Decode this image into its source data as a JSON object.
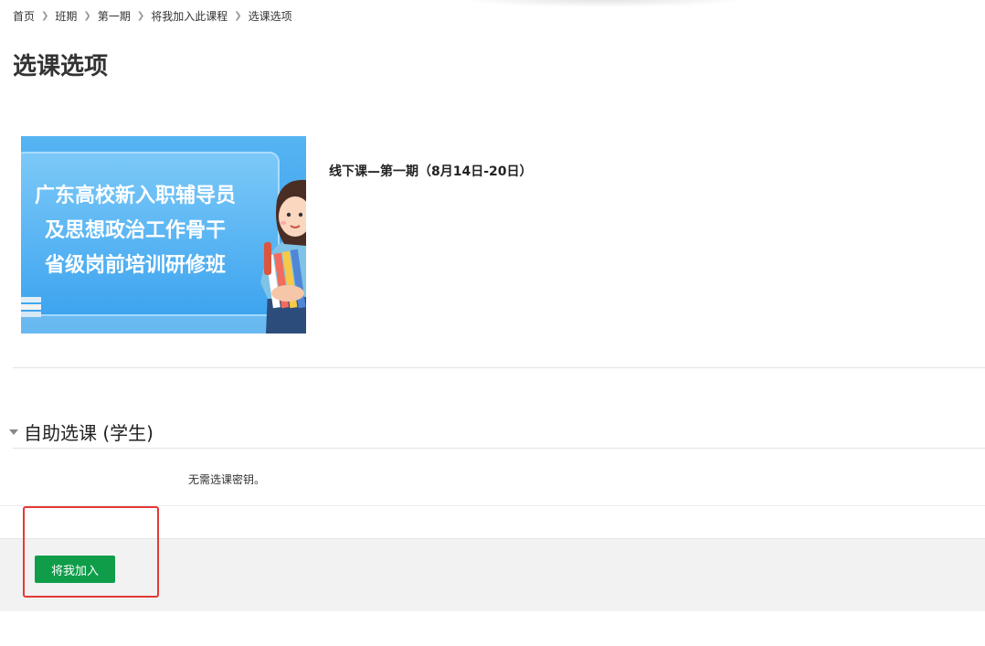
{
  "breadcrumb": [
    "首页",
    "班期",
    "第一期",
    "将我加入此课程",
    "选课选项"
  ],
  "page_title": "选课选项",
  "course": {
    "name": "线下课—第一期（8月14日-20日）",
    "banner_lines": [
      "广东高校新入职辅导员",
      "及思想政治工作骨干",
      "省级岗前培训研修班"
    ]
  },
  "section": {
    "title": "自助选课 (学生)",
    "note": "无需选课密钥。",
    "button_label": "将我加入"
  },
  "colors": {
    "button": "#0f9d4a",
    "highlight": "#e53935",
    "banner": "#3aa2ee"
  }
}
